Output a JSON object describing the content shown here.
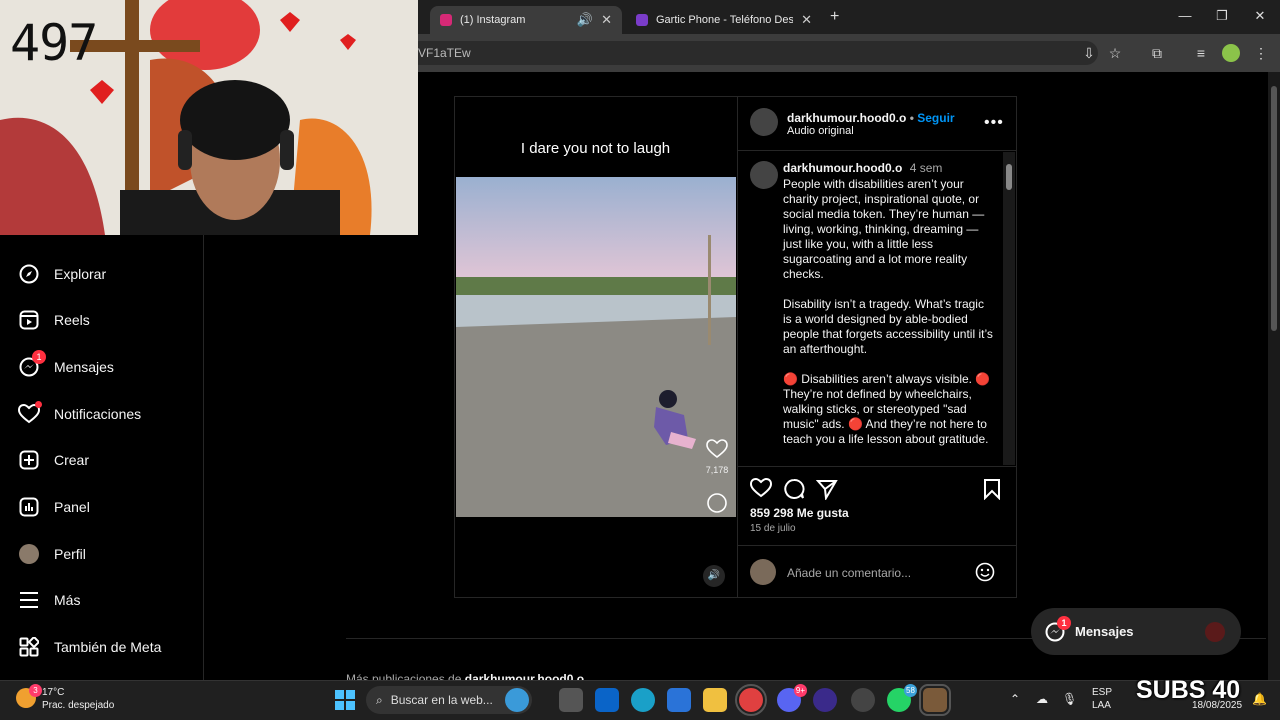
{
  "browser": {
    "tabs": [
      {
        "title": "(1) Instagram",
        "active": true,
        "favicon_color": "#d62976"
      },
      {
        "title": "Gartic Phone - Teléfono Descon",
        "active": false,
        "favicon_color": "#7a3cc9"
      }
    ],
    "url_fragment": "VF1aTEw",
    "new_tab_symbol": "+"
  },
  "webcam": {
    "counter": "497"
  },
  "sidebar": {
    "items": [
      {
        "label": "Explorar",
        "icon": "compass-icon"
      },
      {
        "label": "Reels",
        "icon": "reels-icon"
      },
      {
        "label": "Mensajes",
        "icon": "messenger-icon",
        "badge": "1"
      },
      {
        "label": "Notificaciones",
        "icon": "heart-icon"
      },
      {
        "label": "Crear",
        "icon": "plus-square-icon"
      },
      {
        "label": "Panel",
        "icon": "chart-icon"
      },
      {
        "label": "Perfil",
        "icon": "avatar-icon"
      },
      {
        "label": "Más",
        "icon": "menu-icon"
      },
      {
        "label": "También de Meta",
        "icon": "meta-apps-icon"
      }
    ]
  },
  "post": {
    "video_caption": "I dare you not to laugh",
    "overlay_likes": "7,178",
    "username": "darkhumour.hood0.o",
    "separator": "•",
    "follow_label": "Seguir",
    "audio": "Audio original",
    "comment_user": "darkhumour.hood0.o",
    "comment_age": "4 sem",
    "comment_paragraphs": [
      "People with disabilities aren’t your charity project, inspirational quote, or social media token. They’re human — living, working, thinking, dreaming — just like you, with a little less sugarcoating and a lot more reality checks.",
      "Disability isn’t a tragedy. What’s tragic is a world designed by able-bodied people that forgets accessibility until it’s an afterthought.",
      "🔴 Disabilities aren’t always visible. 🔴 They’re not defined by wheelchairs, walking sticks, or stereotyped \"sad music\" ads. 🔴 And they’re not here to teach you a life lesson about gratitude."
    ],
    "likes": "859 298 Me gusta",
    "date": "15 de julio",
    "comment_placeholder": "Añade un comentario...",
    "more_from_prefix": "Más publicaciones de",
    "more_from_user": "darkhumour.hood0.o"
  },
  "messages_pill": {
    "label": "Mensajes",
    "badge": "1"
  },
  "taskbar": {
    "weather_temp": "17°C",
    "weather_desc": "Prac. despejado",
    "weather_badge": "3",
    "search_placeholder": "Buscar en la web...",
    "discord_badge": "9+",
    "whatsapp_badge": "58",
    "lang_line1": "ESP",
    "lang_line2": "LAA",
    "date": "18/08/2025"
  },
  "overlay": {
    "subs": "SUBS 40"
  },
  "colors": {
    "accent": "#0095f6",
    "notification": "#ff3040",
    "page_bg": "#000000"
  }
}
